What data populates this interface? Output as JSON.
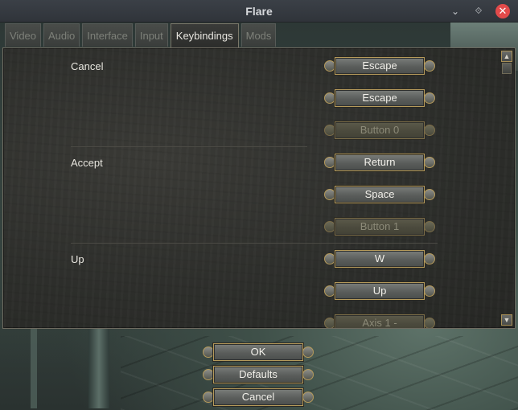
{
  "window": {
    "title": "Flare",
    "minimize_glyph": "⌄",
    "maximize_glyph": "⟐",
    "close_glyph": "✕"
  },
  "tabs": [
    {
      "label": "Video",
      "active": false
    },
    {
      "label": "Audio",
      "active": false
    },
    {
      "label": "Interface",
      "active": false
    },
    {
      "label": "Input",
      "active": false
    },
    {
      "label": "Keybindings",
      "active": true
    },
    {
      "label": "Mods",
      "active": false
    }
  ],
  "keybindings": [
    {
      "action": "Cancel",
      "bindings": [
        {
          "label": "Escape",
          "enabled": true
        },
        {
          "label": "Escape",
          "enabled": true
        },
        {
          "label": "Button 0",
          "enabled": false
        }
      ]
    },
    {
      "action": "Accept",
      "bindings": [
        {
          "label": "Return",
          "enabled": true
        },
        {
          "label": "Space",
          "enabled": true
        },
        {
          "label": "Button 1",
          "enabled": false
        }
      ]
    },
    {
      "action": "Up",
      "bindings": [
        {
          "label": "W",
          "enabled": true
        },
        {
          "label": "Up",
          "enabled": true
        },
        {
          "label": "Axis 1 -",
          "enabled": false
        }
      ]
    }
  ],
  "scrollbar": {
    "up_glyph": "▲",
    "down_glyph": "▼"
  },
  "footer": {
    "ok_label": "OK",
    "defaults_label": "Defaults",
    "cancel_label": "Cancel"
  },
  "colors": {
    "accent_gold": "#b59a5b",
    "text": "#e8e6df",
    "close_button": "#e24a4a"
  }
}
